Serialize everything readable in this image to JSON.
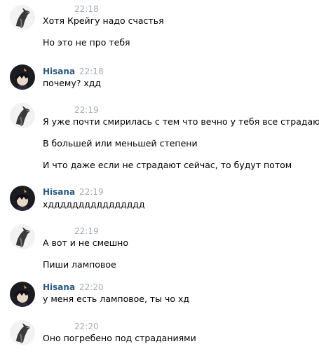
{
  "colors": {
    "author": "#2a5885",
    "time": "#a3adb8",
    "text": "#000000",
    "background": "#ffffff"
  },
  "groups": [
    {
      "avatar": "wolf-avatar",
      "author": "",
      "time": "22:18",
      "messages": [
        "Хотя Крейгу надо счастья",
        "Но это не про тебя"
      ]
    },
    {
      "avatar": "hisana-avatar",
      "author": "Hisana",
      "time": "22:18",
      "messages": [
        "почему? хдд"
      ]
    },
    {
      "avatar": "wolf-avatar",
      "author": "",
      "time": "22:19",
      "messages": [
        "Я уже почти смирилась с тем что вечно у тебя все страдают",
        "В большей или меньшей степени",
        "И что даже если не страдают сейчас, то будут потом"
      ]
    },
    {
      "avatar": "hisana-avatar",
      "author": "Hisana",
      "time": "22:19",
      "messages": [
        "хдддддддддддддддд"
      ]
    },
    {
      "avatar": "wolf-avatar",
      "author": "",
      "time": "22:19",
      "messages": [
        "А вот и не смешно",
        "Пиши ламповое"
      ]
    },
    {
      "avatar": "hisana-avatar",
      "author": "Hisana",
      "time": "22:20",
      "messages": [
        "у меня есть ламповое, ты чо хд"
      ]
    },
    {
      "avatar": "wolf-avatar",
      "author": "",
      "time": "22:20",
      "messages": [
        "Оно погребено под страданиями"
      ]
    }
  ]
}
